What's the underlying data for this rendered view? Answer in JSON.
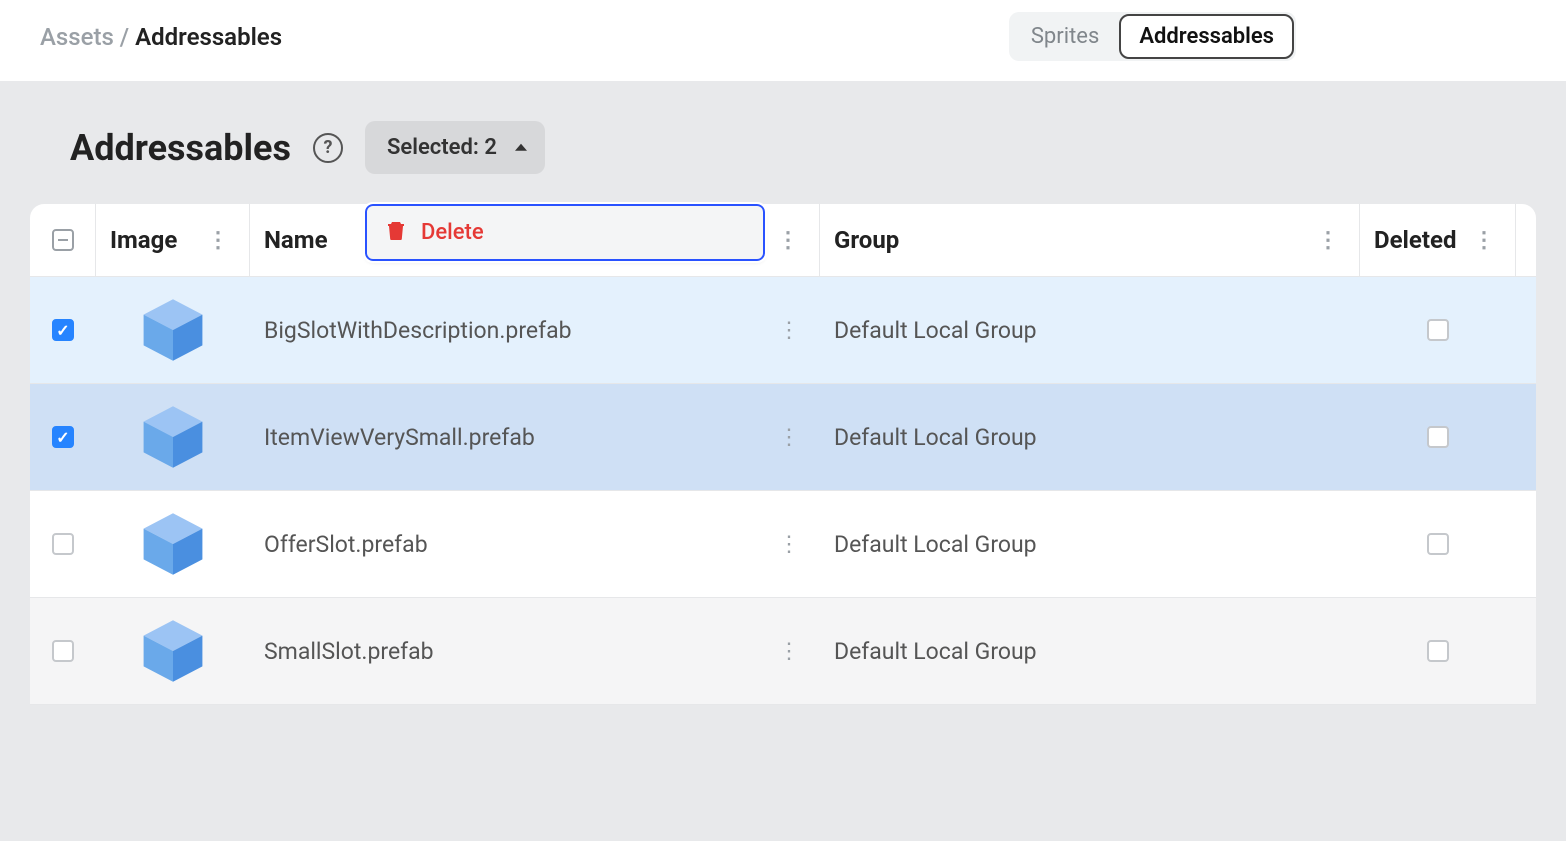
{
  "breadcrumb": {
    "root": "Assets",
    "sep": " / ",
    "current": "Addressables"
  },
  "tabs": {
    "sprites": "Sprites",
    "addressables": "Addressables"
  },
  "page": {
    "title": "Addressables"
  },
  "selected": {
    "label": "Selected: 2"
  },
  "dropdown": {
    "delete": "Delete"
  },
  "columns": {
    "image": "Image",
    "name": "Name",
    "group": "Group",
    "deleted": "Deleted"
  },
  "rows": [
    {
      "name": "BigSlotWithDescription.prefab",
      "group": "Default Local Group",
      "checked": true,
      "deleted": false,
      "style": "sel-light"
    },
    {
      "name": "ItemViewVerySmall.prefab",
      "group": "Default Local Group",
      "checked": true,
      "deleted": false,
      "style": "sel-dark"
    },
    {
      "name": "OfferSlot.prefab",
      "group": "Default Local Group",
      "checked": false,
      "deleted": false,
      "style": ""
    },
    {
      "name": "SmallSlot.prefab",
      "group": "Default Local Group",
      "checked": false,
      "deleted": false,
      "style": "alt"
    }
  ]
}
